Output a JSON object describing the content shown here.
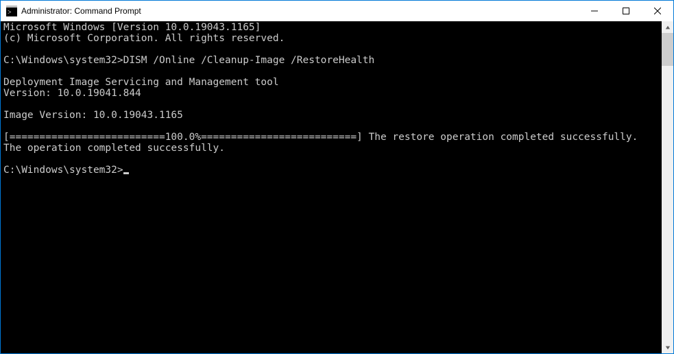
{
  "window": {
    "title": "Administrator: Command Prompt"
  },
  "terminal": {
    "lines": [
      "Microsoft Windows [Version 10.0.19043.1165]",
      "(c) Microsoft Corporation. All rights reserved.",
      "",
      "C:\\Windows\\system32>DISM /Online /Cleanup-Image /RestoreHealth",
      "",
      "Deployment Image Servicing and Management tool",
      "Version: 10.0.19041.844",
      "",
      "Image Version: 10.0.19043.1165",
      "",
      "[==========================100.0%==========================] The restore operation completed successfully.",
      "The operation completed successfully.",
      ""
    ],
    "prompt": "C:\\Windows\\system32>"
  }
}
